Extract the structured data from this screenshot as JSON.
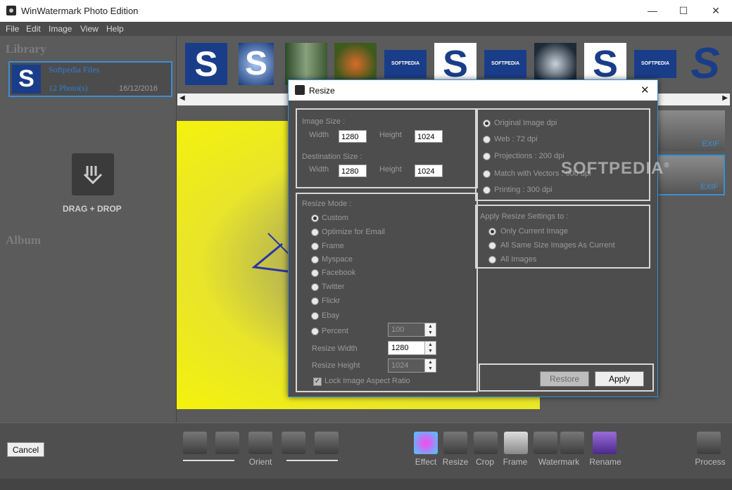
{
  "window": {
    "title": "WinWatermark Photo Edition",
    "min": "—",
    "max": "☐",
    "close": "✕"
  },
  "menu": [
    "File",
    "Edit",
    "Image",
    "View",
    "Help"
  ],
  "library": {
    "title": "Library",
    "item": {
      "name": "Softpedia Files",
      "count": "12 Photo(s)",
      "date": "16/12/2016",
      "logo": "S"
    },
    "drag_drop": "DRAG + DROP",
    "album_title": "Album"
  },
  "thumbs": [
    {
      "kind": "s-logo",
      "text": "S"
    },
    {
      "kind": "s-swirl",
      "text": "S"
    },
    {
      "kind": "forest",
      "text": ""
    },
    {
      "kind": "autumn",
      "text": ""
    },
    {
      "kind": "softpedia",
      "text": "SOFTPEDIA"
    },
    {
      "kind": "s-logo-w",
      "text": "S"
    },
    {
      "kind": "softpedia",
      "text": "SOFTPEDIA"
    },
    {
      "kind": "dark",
      "text": ""
    },
    {
      "kind": "s-logo-w",
      "text": "S"
    },
    {
      "kind": "softpedia",
      "text": "SOFTPEDIA"
    },
    {
      "kind": "s-big",
      "text": "S"
    }
  ],
  "right_panel": {
    "exif1": "EXIF",
    "exif2": "EXIF"
  },
  "toolbar": {
    "cancel": "Cancel",
    "orient_label": "Orient",
    "tools": [
      "Effect",
      "Resize",
      "Crop",
      "Frame",
      "Watermark",
      "Rename"
    ],
    "process": "Process"
  },
  "dialog": {
    "title": "Resize",
    "close": "✕",
    "image_size_label": "Image Size :",
    "width_label": "Width",
    "height_label": "Height",
    "image_width": "1280",
    "image_height": "1024",
    "dest_size_label": "Destination Size :",
    "dest_width": "1280",
    "dest_height": "1024",
    "resize_mode_label": "Resize Mode :",
    "modes": [
      "Custom",
      "Optimize for Email",
      "Frame",
      "Myspace",
      "Facebook",
      "Twitter",
      "Flickr",
      "Ebay",
      "Percent"
    ],
    "selected_mode": "Custom",
    "percent_value": "100",
    "resize_width_label": "Resize Width",
    "resize_width": "1280",
    "resize_height_label": "Resize Height",
    "resize_height": "1024",
    "lock_aspect_label": "Lock Image Aspect Ratio",
    "lock_aspect_checked": true,
    "dpi_options": [
      "Original Image dpi",
      "Web : 72 dpi",
      "Projections : 200 dpi",
      "Match with Vectors : 600 dpi",
      "Printing : 300 dpi"
    ],
    "selected_dpi": "Original Image dpi",
    "apply_settings_label": "Apply Resize Settings to :",
    "apply_options": [
      "Only Current Image",
      "All Same Size Images As Current",
      "All Images"
    ],
    "selected_apply": "Only Current Image",
    "restore": "Restore",
    "apply": "Apply",
    "watermark_text": "SOFTPEDIA",
    "watermark_reg": "®"
  },
  "colors": {
    "accent": "#3b8fd6",
    "bg": "#5a5a5a",
    "dialog_bg": "#4d4d4d",
    "preview_yellow": "#f5f20c"
  }
}
